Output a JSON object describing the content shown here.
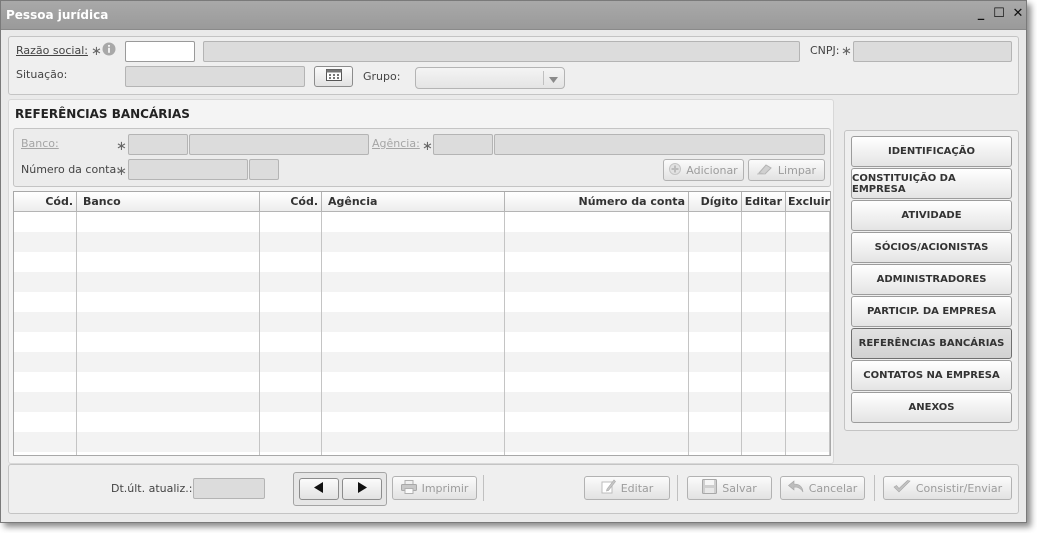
{
  "window": {
    "title": "Pessoa jurídica",
    "minimize_glyph": "_",
    "maximize_glyph": "☐",
    "close_glyph": "✕"
  },
  "header_form": {
    "razao_social_label": "Razão social:",
    "razao_social_code_value": "",
    "razao_social_name_value": "",
    "cnpj_label": "CNPJ:",
    "cnpj_value": "",
    "situacao_label": "Situação:",
    "situacao_value": "",
    "grupo_label": "Grupo:",
    "grupo_value": ""
  },
  "bank_section": {
    "title": "REFERÊNCIAS BANCÁRIAS",
    "banco_label": "Banco:",
    "agencia_label": "Agência:",
    "numero_conta_label": "Número da conta:",
    "add_label": "Adicionar",
    "clear_label": "Limpar"
  },
  "table": {
    "columns": [
      "Cód.",
      "Banco",
      "Cód.",
      "Agência",
      "Número da conta",
      "Dígito",
      "Editar",
      "Excluir"
    ],
    "rows": []
  },
  "side_nav": {
    "items": [
      {
        "label": "IDENTIFICAÇÃO"
      },
      {
        "label": "CONSTITUIÇÃO DA EMPRESA"
      },
      {
        "label": "ATIVIDADE"
      },
      {
        "label": "SÓCIOS/ACIONISTAS"
      },
      {
        "label": "ADMINISTRADORES"
      },
      {
        "label": "PARTICIP. DA EMPRESA"
      },
      {
        "label": "REFERÊNCIAS BANCÁRIAS"
      },
      {
        "label": "CONTATOS NA EMPRESA"
      },
      {
        "label": "ANEXOS"
      }
    ],
    "active_index": 6
  },
  "footer": {
    "dt_label": "Dt.últ. atualiz.:",
    "dt_value": "",
    "print_label": "Imprimir",
    "edit_label": "Editar",
    "save_label": "Salvar",
    "cancel_label": "Cancelar",
    "submit_label": "Consistir/Enviar"
  },
  "icons": {
    "info": "info-icon",
    "calendar": "calendar-icon",
    "dropdown": "chevron-down-icon",
    "prev": "triangle-left-icon",
    "next": "triangle-right-icon",
    "print": "printer-icon",
    "edit": "pencil-icon",
    "save": "floppy-disk-icon",
    "cancel": "undo-icon",
    "submit": "checkmark-icon",
    "add": "plus-icon",
    "clear": "eraser-icon"
  }
}
